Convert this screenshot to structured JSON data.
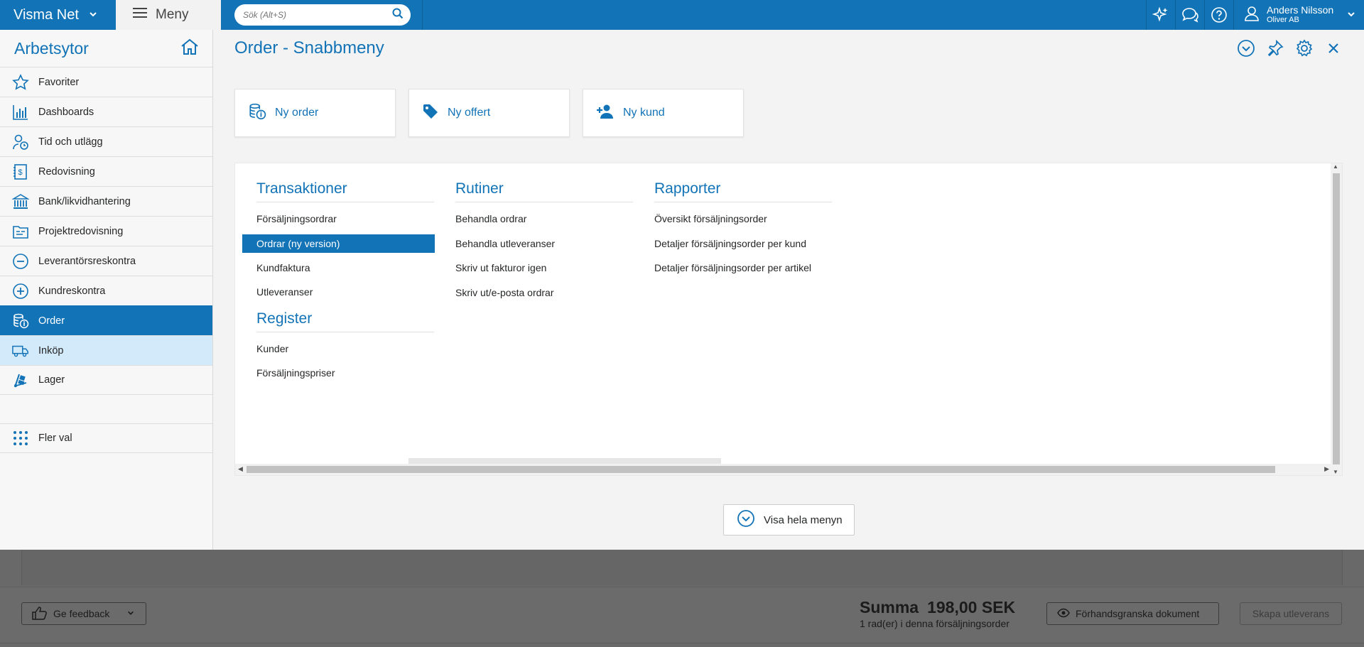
{
  "topbar": {
    "brand": "Visma Net",
    "menu_label": "Meny",
    "search_placeholder": "Sök (Alt+S)",
    "user_name": "Anders Nilsson",
    "user_company": "Oliver AB"
  },
  "sidebar": {
    "title": "Arbetsytor",
    "items": [
      {
        "label": "Favoriter",
        "icon": "star-icon"
      },
      {
        "label": "Dashboards",
        "icon": "bar-chart-icon"
      },
      {
        "label": "Tid och utlägg",
        "icon": "time-expense-icon"
      },
      {
        "label": "Redovisning",
        "icon": "ledger-icon"
      },
      {
        "label": "Bank/likvidhantering",
        "icon": "bank-icon"
      },
      {
        "label": "Projektredovisning",
        "icon": "project-icon"
      },
      {
        "label": "Leverantörsreskontra",
        "icon": "minus-circle-icon"
      },
      {
        "label": "Kundreskontra",
        "icon": "plus-circle-icon"
      },
      {
        "label": "Order",
        "icon": "order-icon"
      },
      {
        "label": "Inköp",
        "icon": "truck-icon"
      },
      {
        "label": "Lager",
        "icon": "hand-truck-icon"
      }
    ],
    "more_label": "Fler val"
  },
  "main": {
    "title": "Order - Snabbmeny",
    "quick_actions": [
      {
        "label": "Ny order",
        "icon": "new-order-icon"
      },
      {
        "label": "Ny offert",
        "icon": "tag-icon"
      },
      {
        "label": "Ny kund",
        "icon": "add-person-icon"
      }
    ],
    "columns": {
      "transaktioner": {
        "title": "Transaktioner",
        "links": [
          "Försäljningsordrar",
          "Ordrar (ny version)",
          "Kundfaktura",
          "Utleveranser"
        ]
      },
      "register": {
        "title": "Register",
        "links": [
          "Kunder",
          "Försäljningspriser"
        ]
      },
      "rutiner": {
        "title": "Rutiner",
        "links": [
          "Behandla ordrar",
          "Behandla utleveranser",
          "Skriv ut fakturor igen",
          "Skriv ut/e-posta ordrar"
        ]
      },
      "rapporter": {
        "title": "Rapporter",
        "links": [
          "Översikt försäljningsorder",
          "Detaljer försäljningsorder per kund",
          "Detaljer försäljningsorder per artikel"
        ]
      }
    },
    "show_all_label": "Visa hela menyn"
  },
  "footer": {
    "feedback_label": "Ge feedback",
    "sum_label": "Summa",
    "sum_value": "198,00 SEK",
    "rows_text": "1 rad(er) i denna försäljningsorder",
    "preview_label": "Förhandsgranska dokument",
    "create_label": "Skapa utleverans"
  },
  "colors": {
    "brand_blue": "#1273b7",
    "active_bg": "#1273b7",
    "hover_bg": "#d3eafa"
  }
}
